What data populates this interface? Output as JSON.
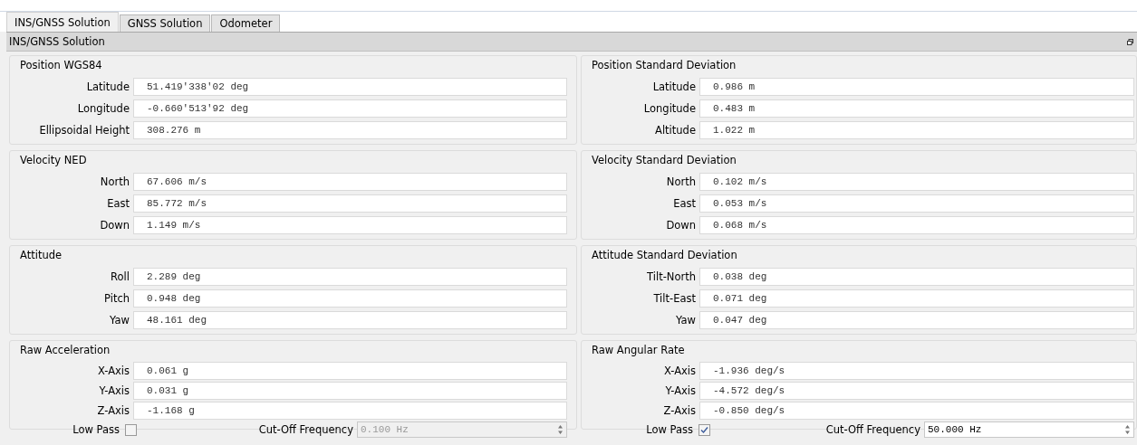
{
  "tabs": [
    {
      "label": "INS/GNSS Solution",
      "selected": true
    },
    {
      "label": "GNSS Solution",
      "selected": false
    },
    {
      "label": "Odometer",
      "selected": false
    }
  ],
  "panel": {
    "title": "INS/GNSS Solution"
  },
  "rows": [
    {
      "left": {
        "title": "Position WGS84",
        "fields": [
          {
            "label": "Latitude",
            "value": "51.419'338'02 deg"
          },
          {
            "label": "Longitude",
            "value": "-0.660'513'92 deg"
          },
          {
            "label": "Ellipsoidal Height",
            "value": "308.276 m"
          }
        ]
      },
      "right": {
        "title": "Position Standard Deviation",
        "fields": [
          {
            "label": "Latitude",
            "value": "0.986 m"
          },
          {
            "label": "Longitude",
            "value": "0.483 m"
          },
          {
            "label": "Altitude",
            "value": "1.022 m"
          }
        ]
      }
    },
    {
      "left": {
        "title": "Velocity NED",
        "fields": [
          {
            "label": "North",
            "value": "67.606 m/s"
          },
          {
            "label": "East",
            "value": "85.772 m/s"
          },
          {
            "label": "Down",
            "value": "1.149 m/s"
          }
        ]
      },
      "right": {
        "title": "Velocity Standard Deviation",
        "fields": [
          {
            "label": "North",
            "value": "0.102 m/s"
          },
          {
            "label": "East",
            "value": "0.053 m/s"
          },
          {
            "label": "Down",
            "value": "0.068 m/s"
          }
        ]
      }
    },
    {
      "left": {
        "title": "Attitude",
        "fields": [
          {
            "label": "Roll",
            "value": "2.289 deg"
          },
          {
            "label": "Pitch",
            "value": "0.948 deg"
          },
          {
            "label": "Yaw",
            "value": "48.161 deg"
          }
        ]
      },
      "right": {
        "title": "Attitude Standard Deviation",
        "fields": [
          {
            "label": "Tilt-North",
            "value": "0.038 deg"
          },
          {
            "label": "Tilt-East",
            "value": "0.071 deg"
          },
          {
            "label": "Yaw",
            "value": "0.047 deg"
          }
        ]
      }
    },
    {
      "left": {
        "title": "Raw Acceleration",
        "fields": [
          {
            "label": "X-Axis",
            "value": "0.061 g"
          },
          {
            "label": "Y-Axis",
            "value": "0.031 g"
          },
          {
            "label": "Z-Axis",
            "value": "-1.168 g"
          }
        ],
        "filter": {
          "low_pass_label": "Low Pass",
          "checked": false,
          "cutoff_label": "Cut-Off Frequency",
          "cutoff_value": "0.100 Hz",
          "disabled": true
        }
      },
      "right": {
        "title": "Raw Angular Rate",
        "fields": [
          {
            "label": "X-Axis",
            "value": "-1.936 deg/s"
          },
          {
            "label": "Y-Axis",
            "value": "-4.572 deg/s"
          },
          {
            "label": "Z-Axis",
            "value": "-0.850 deg/s"
          }
        ],
        "filter": {
          "low_pass_label": "Low Pass",
          "checked": true,
          "cutoff_label": "Cut-Off Frequency",
          "cutoff_value": "50.000 Hz",
          "disabled": false
        }
      }
    }
  ]
}
